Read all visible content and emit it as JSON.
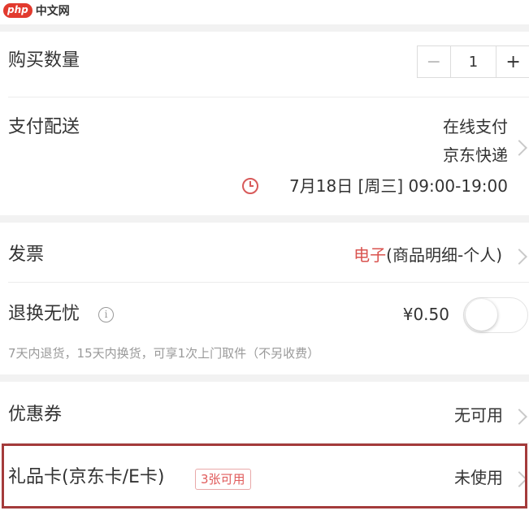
{
  "brand": {
    "logo_badge": "php",
    "logo_text": "中文网"
  },
  "quantity": {
    "label": "购买数量",
    "minus": "−",
    "value": "1",
    "plus": "+"
  },
  "payment": {
    "label": "支付配送",
    "method": "在线支付",
    "courier": "京东快递",
    "delivery_time": "7月18日 [周三] 09:00-19:00"
  },
  "invoice": {
    "label": "发票",
    "type_highlight": "电子",
    "detail": "(商品明细-个人)"
  },
  "return_service": {
    "label": "退换无忧",
    "info_icon": "i",
    "price": "¥0.50",
    "enabled": false,
    "description": "7天内退货，15天内换货，可享1次上门取件（不另收费）"
  },
  "coupon": {
    "label": "优惠券",
    "status": "无可用"
  },
  "gift_card": {
    "label": "礼品卡(京东卡/E卡)",
    "badge": "3张可用",
    "status": "未使用"
  },
  "colors": {
    "accent": "#e05b5b",
    "highlight_border": "#a43b3b",
    "section_gap": "#f2f2f2"
  },
  "icons": [
    "chevron-right-icon",
    "clock-icon",
    "info-icon",
    "toggle-switch"
  ]
}
